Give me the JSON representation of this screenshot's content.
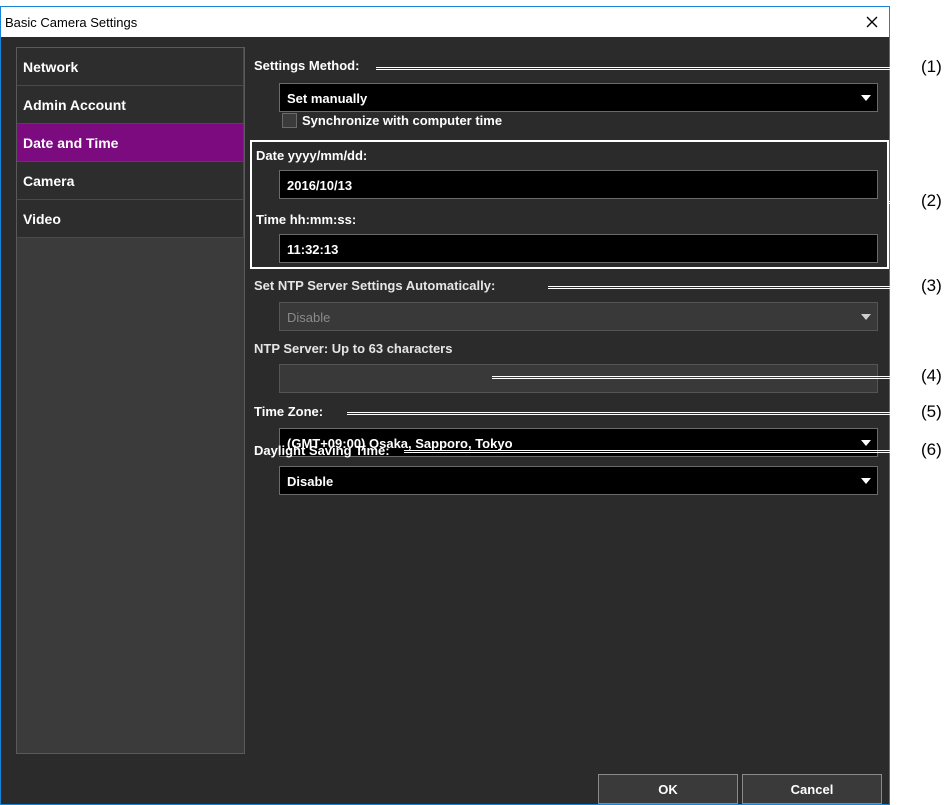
{
  "window": {
    "title": "Basic Camera Settings",
    "close_icon": "close-icon"
  },
  "sidebar": {
    "items": [
      {
        "label": "Network"
      },
      {
        "label": "Admin Account"
      },
      {
        "label": "Date and Time",
        "active": true
      },
      {
        "label": "Camera"
      },
      {
        "label": "Video"
      }
    ]
  },
  "form": {
    "settings_method_label": "Settings Method:",
    "settings_method_value": "Set manually",
    "sync_label": "Synchronize with computer time",
    "date_label": "Date  yyyy/mm/dd:",
    "date_value": "2016/10/13",
    "time_label": "Time  hh:mm:ss:",
    "time_value": "11:32:13",
    "ntp_auto_label": "Set NTP Server Settings Automatically:",
    "ntp_auto_value": "Disable",
    "ntp_server_label": "NTP Server:  Up to 63 characters",
    "ntp_server_value": "",
    "timezone_label": "Time Zone:",
    "timezone_value": "(GMT+09:00) Osaka, Sapporo, Tokyo",
    "dst_label": "Daylight Saving Time:",
    "dst_value": "Disable"
  },
  "callouts": [
    "(1)",
    "(2)",
    "(3)",
    "(4)",
    "(5)",
    "(6)"
  ],
  "footer": {
    "ok_label": "OK",
    "cancel_label": "Cancel"
  },
  "colors": {
    "accent": "#7d0b80",
    "window_bg": "#2b2b2b",
    "border_accent": "#1783d4"
  }
}
